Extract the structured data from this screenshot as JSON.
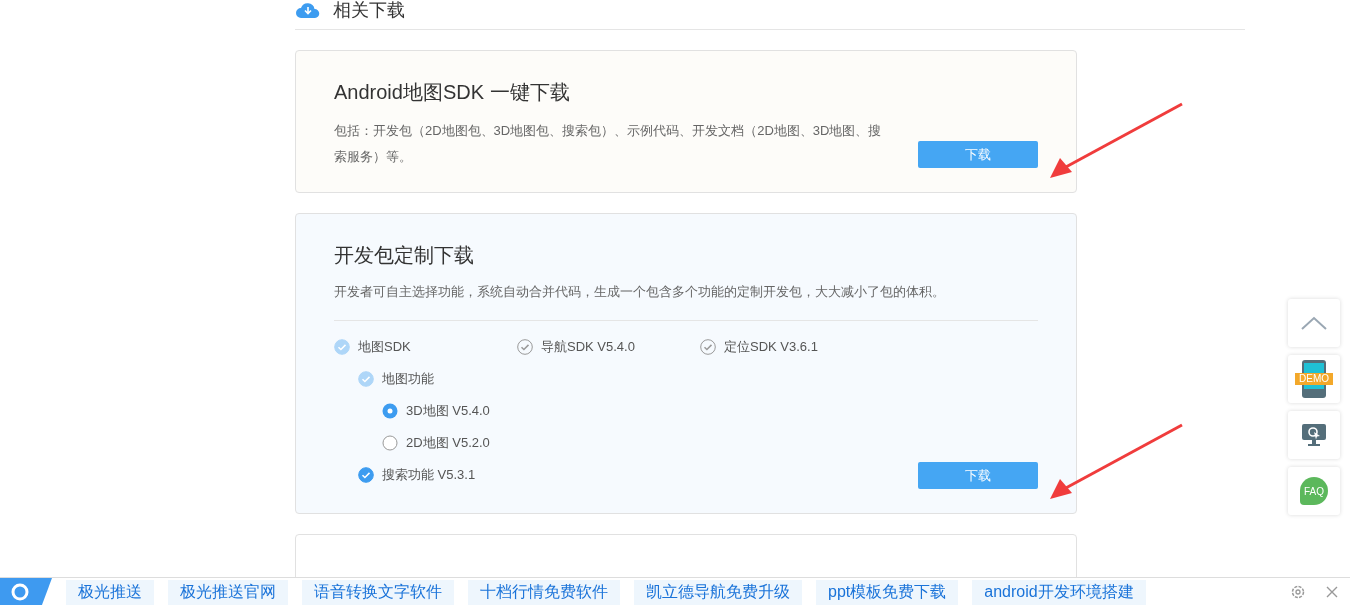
{
  "section": {
    "title": "相关下载"
  },
  "cards": [
    {
      "kind": "simple",
      "title": "Android地图SDK 一键下载",
      "description": "包括：开发包（2D地图包、3D地图包、搜索包）、示例代码、开发文档（2D地图、3D地图、搜索服务）等。",
      "button": "下载"
    },
    {
      "kind": "custom",
      "title": "开发包定制下载",
      "description": "开发者可自主选择功能，系统自动合并代码，生成一个包含多个功能的定制开发包，大大减小了包的体积。",
      "button": "下载",
      "options": [
        {
          "kind": "checkbox",
          "label": "地图SDK",
          "checked": true,
          "disabled": true,
          "children": [
            {
              "kind": "checkbox",
              "label": "地图功能",
              "checked": true,
              "disabled": true,
              "children": [
                {
                  "kind": "radio",
                  "label": "3D地图 V5.4.0",
                  "selected": true
                },
                {
                  "kind": "radio",
                  "label": "2D地图 V5.2.0",
                  "selected": false
                }
              ]
            },
            {
              "kind": "checkbox",
              "label": "搜索功能 V5.3.1",
              "checked": true,
              "disabled": false
            }
          ]
        },
        {
          "kind": "checkbox",
          "label": "导航SDK V5.4.0",
          "checked": false,
          "disabled": false
        },
        {
          "kind": "checkbox",
          "label": "定位SDK V3.6.1",
          "checked": false,
          "disabled": false
        }
      ]
    }
  ],
  "side_tools": [
    {
      "kind": "top"
    },
    {
      "kind": "demo",
      "label": "DEMO"
    },
    {
      "kind": "monitor"
    },
    {
      "kind": "faq",
      "label": "FAQ"
    }
  ],
  "bottom_bar": {
    "links": [
      "极光推送",
      "极光推送官网",
      "语音转换文字软件",
      "十档行情免费软件",
      "凯立德导航免费升级",
      "ppt模板免费下载",
      "android开发环境搭建"
    ]
  }
}
